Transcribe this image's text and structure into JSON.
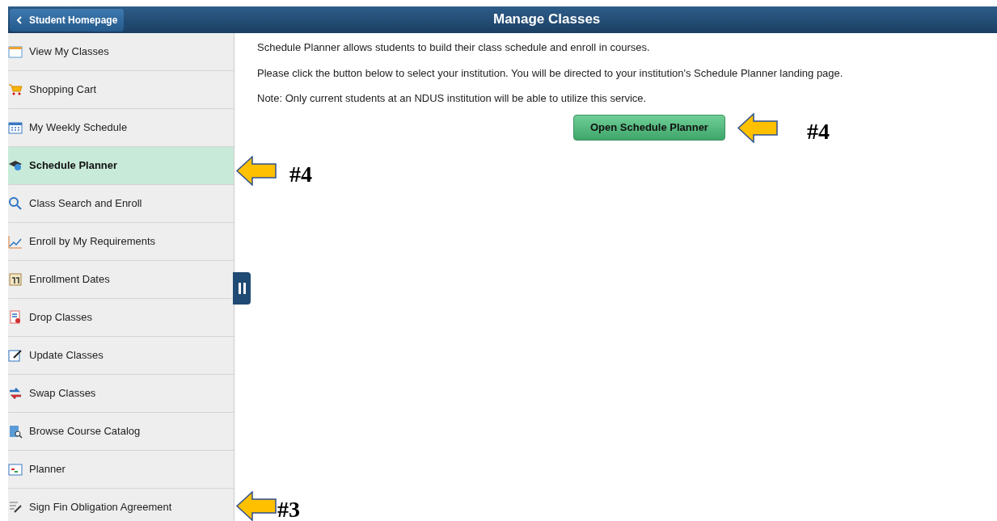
{
  "header": {
    "back_button": "Student Homepage",
    "title": "Manage Classes"
  },
  "sidebar": {
    "items": [
      {
        "label": "View My Classes",
        "selected": false
      },
      {
        "label": "Shopping Cart",
        "selected": false
      },
      {
        "label": "My Weekly Schedule",
        "selected": false
      },
      {
        "label": "Schedule Planner",
        "selected": true
      },
      {
        "label": "Class Search and Enroll",
        "selected": false
      },
      {
        "label": "Enroll by My Requirements",
        "selected": false
      },
      {
        "label": "Enrollment Dates",
        "selected": false
      },
      {
        "label": "Drop Classes",
        "selected": false
      },
      {
        "label": "Update Classes",
        "selected": false
      },
      {
        "label": "Swap Classes",
        "selected": false
      },
      {
        "label": "Browse Course Catalog",
        "selected": false
      },
      {
        "label": "Planner",
        "selected": false
      },
      {
        "label": "Sign Fin Obligation Agreement",
        "selected": false
      }
    ]
  },
  "content": {
    "paragraphs": [
      "Schedule Planner allows students to build their class schedule and enroll in courses.",
      "Please click the button below to select your institution. You will be directed to your institution's Schedule Planner landing page.",
      "Note: Only current students at an NDUS institution will be able to utilize this service."
    ],
    "button": "Open Schedule Planner"
  },
  "annotations": [
    {
      "label": "#4"
    },
    {
      "label": "#4"
    },
    {
      "label": "#3"
    }
  ]
}
